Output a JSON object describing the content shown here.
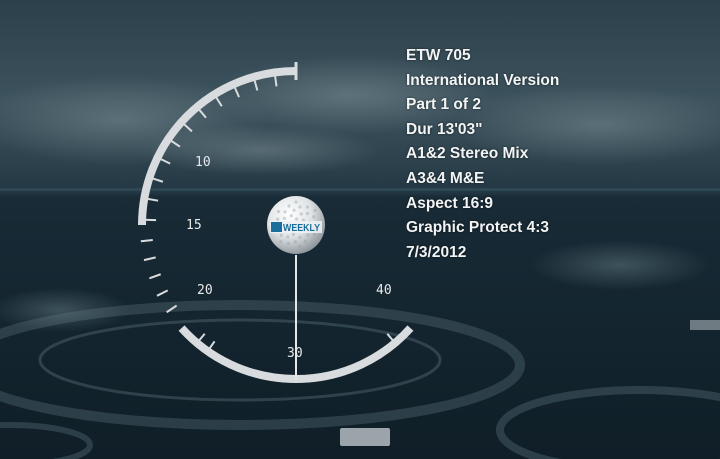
{
  "slate": {
    "lines": [
      "ETW 705",
      "International Version",
      "Part 1 of  2",
      "Dur 13'03\"",
      "A1&2 Stereo Mix",
      "A3&4 M&E",
      "Aspect 16:9",
      "Graphic Protect 4:3",
      "7/3/2012"
    ]
  },
  "countdown": {
    "labels": {
      "l10": "10",
      "l15": "15",
      "l20": "20",
      "l30": "30",
      "l40": "40"
    }
  },
  "logo": {
    "prefix": "ETW",
    "text": "WEEKLY"
  },
  "colors": {
    "sky_top": "#2d4350",
    "sea": "#142530",
    "dial": "#d9dcde"
  }
}
